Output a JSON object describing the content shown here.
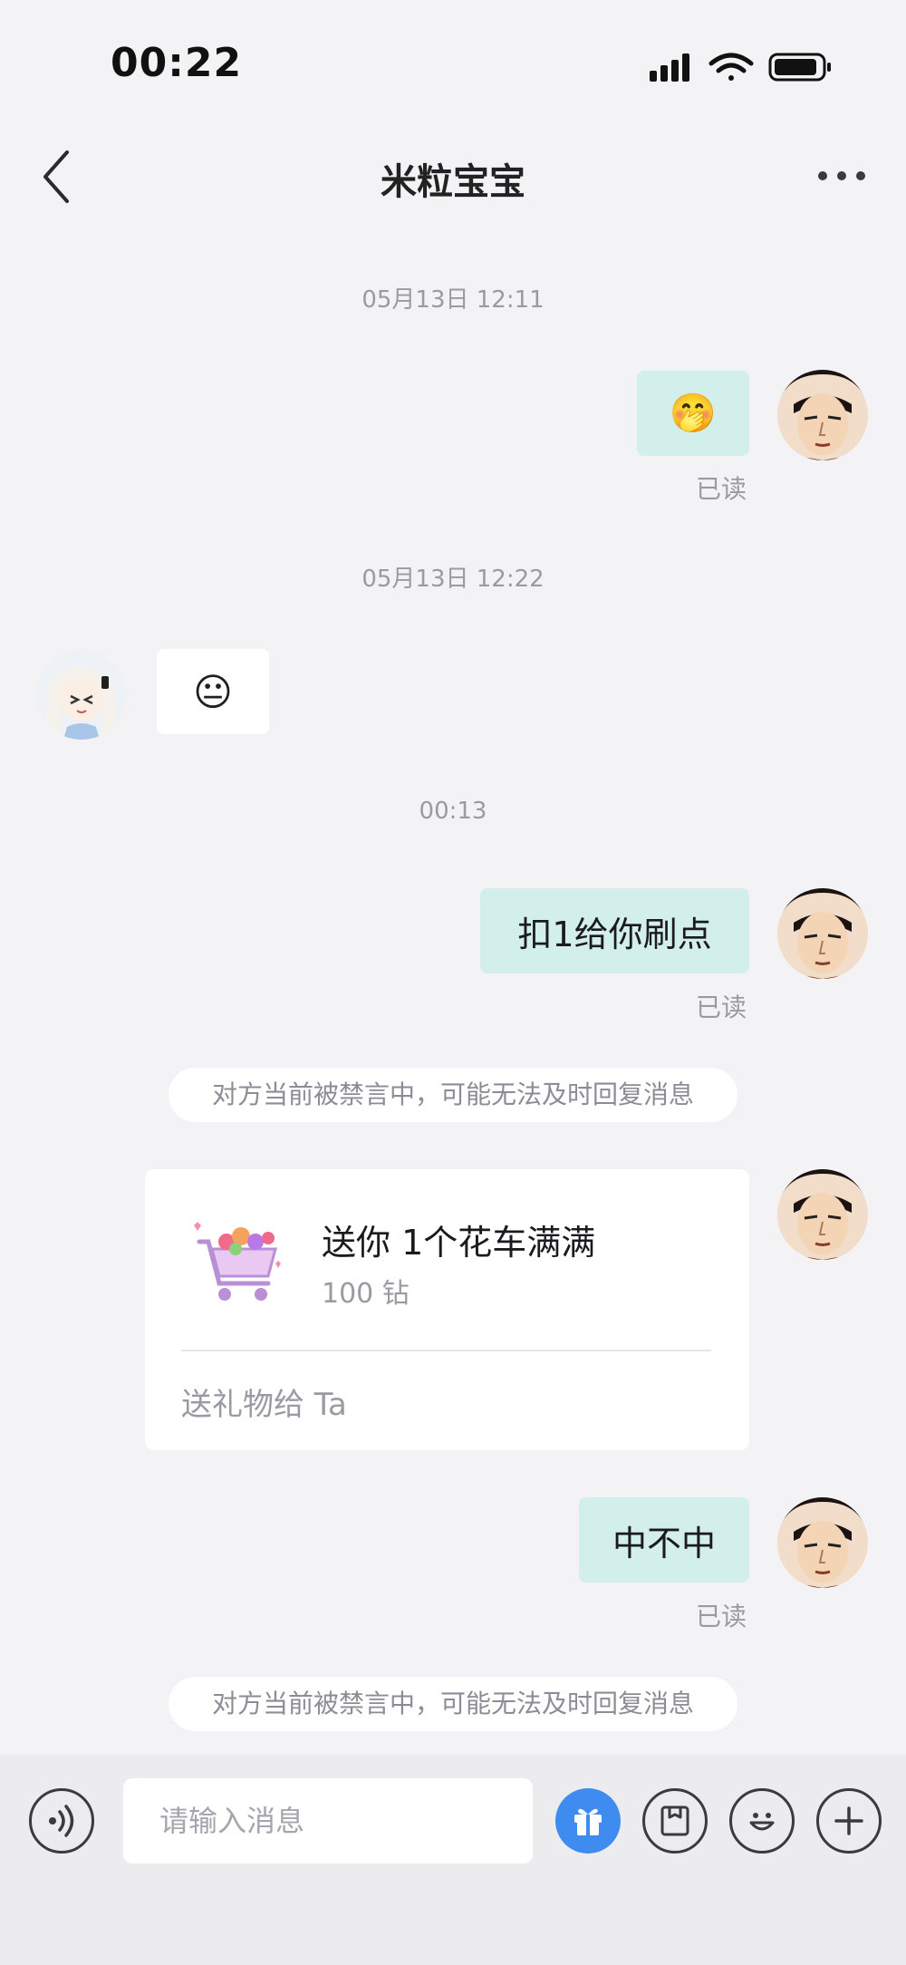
{
  "status_bar": {
    "time": "00:22"
  },
  "header": {
    "title": "米粒宝宝"
  },
  "messages": {
    "time1": "05月13日 12:11",
    "msg1_emoji": "🤭",
    "msg1_read": "已读",
    "time2": "05月13日 12:22",
    "msg2_emoji": "😐",
    "time3": "00:13",
    "msg3_text": "扣1给你刷点",
    "msg3_read": "已读",
    "notice1": "对方当前被禁言中，可能无法及时回复消息",
    "gift": {
      "title": "送你 1个花车满满",
      "price": "100 钻",
      "action": "送礼物给 Ta"
    },
    "msg4_text": "中不中",
    "msg4_read": "已读",
    "notice2": "对方当前被禁言中，可能无法及时回复消息"
  },
  "input_bar": {
    "placeholder": "请输入消息"
  }
}
